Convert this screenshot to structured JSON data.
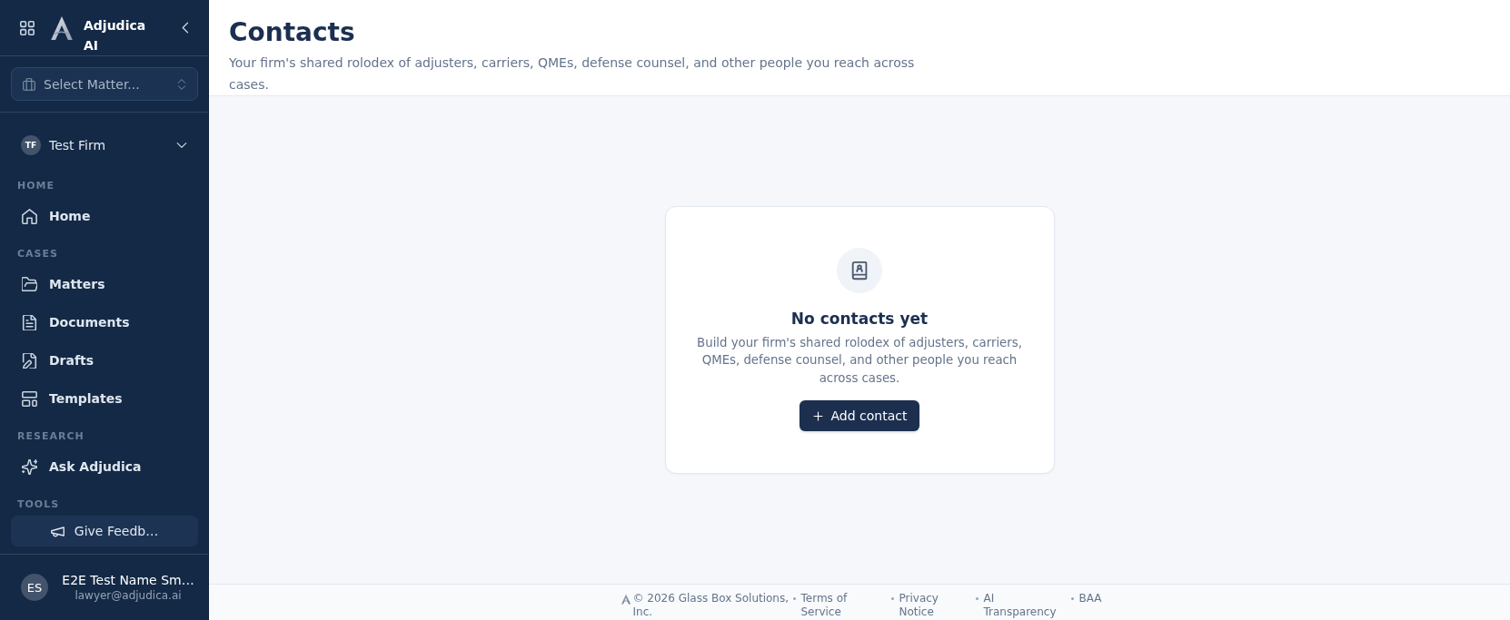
{
  "sidebar": {
    "brand": "Adjudica AI",
    "matter_select": {
      "placeholder": "Select Matter..."
    },
    "firm": {
      "initials": "TF",
      "name": "Test Firm"
    },
    "sections": [
      {
        "label": "HOME",
        "items": [
          {
            "kind": "link",
            "label": "Home",
            "selected": false
          }
        ]
      },
      {
        "label": "CASES",
        "items": [
          {
            "kind": "link",
            "label": "Matters",
            "selected": false
          },
          {
            "kind": "link",
            "label": "Documents",
            "selected": false
          },
          {
            "kind": "link",
            "label": "Drafts",
            "selected": false
          },
          {
            "kind": "link",
            "label": "Templates",
            "selected": false
          }
        ]
      },
      {
        "label": "RESEARCH",
        "items": [
          {
            "kind": "link",
            "label": "Ask Adjudica",
            "selected": false
          }
        ]
      },
      {
        "label": "TOOLS",
        "items": [
          {
            "kind": "button",
            "label": "Give Feedb…"
          }
        ]
      }
    ],
    "user": {
      "initials": "ES",
      "name": "E2E Test Name Sm…",
      "email": "lawyer@adjudica.ai"
    }
  },
  "header": {
    "title": "Contacts",
    "subtitle": "Your firm's shared rolodex of adjusters, carriers, QMEs, defense counsel, and other people you reach across cases."
  },
  "empty_state": {
    "title": "No contacts yet",
    "description": "Build your firm's shared rolodex of adjusters, carriers, QMEs, defense counsel, and other people you reach across cases.",
    "button": "Add contact"
  },
  "footer": {
    "copyright": "© 2026 Glass Box Solutions, Inc.",
    "links": [
      "Terms of Service",
      "Privacy Notice",
      "AI Transparency",
      "BAA"
    ]
  }
}
